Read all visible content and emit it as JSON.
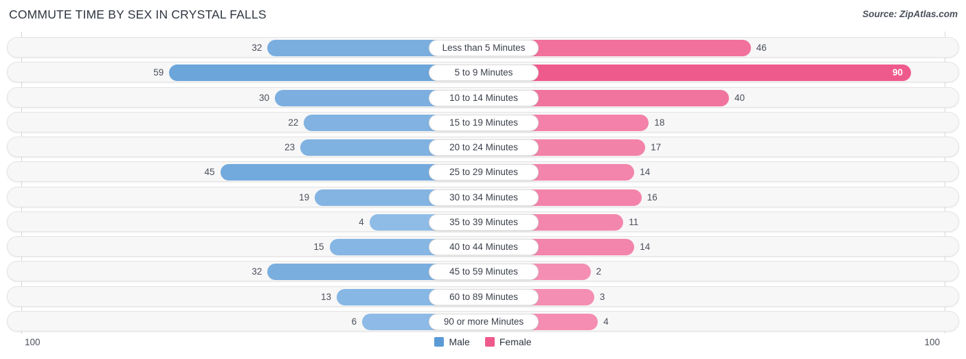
{
  "header": {
    "title": "COMMUTE TIME BY SEX IN CRYSTAL FALLS",
    "source": "Source: ZipAtlas.com"
  },
  "axis": {
    "left_label": "100",
    "right_label": "100"
  },
  "legend": {
    "items": [
      {
        "label": "Male",
        "color": "#5b9bd5"
      },
      {
        "label": "Female",
        "color": "#ef5a8c"
      }
    ]
  },
  "colors": {
    "male_strong": "#5b9bd5",
    "male_light": "#95bfe8",
    "female_strong": "#ef5a8c",
    "female_light": "#f492b5",
    "track": "#f7f7f7",
    "track_border": "#e3e3e3",
    "grid": "#d8d8d8"
  },
  "chart_data": {
    "type": "bar",
    "title": "COMMUTE TIME BY SEX IN CRYSTAL FALLS",
    "subtitle": "Source: ZipAtlas.com",
    "orientation": "horizontal-diverging",
    "xlabel": "",
    "ylabel": "",
    "xlim": [
      0,
      100
    ],
    "grid": true,
    "legend_position": "bottom-center",
    "categories": [
      "Less than 5 Minutes",
      "5 to 9 Minutes",
      "10 to 14 Minutes",
      "15 to 19 Minutes",
      "20 to 24 Minutes",
      "25 to 29 Minutes",
      "30 to 34 Minutes",
      "35 to 39 Minutes",
      "40 to 44 Minutes",
      "45 to 59 Minutes",
      "60 to 89 Minutes",
      "90 or more Minutes"
    ],
    "series": [
      {
        "name": "Male",
        "side": "left",
        "color": "#5b9bd5",
        "values": [
          32,
          59,
          30,
          22,
          23,
          45,
          19,
          4,
          15,
          32,
          13,
          6
        ]
      },
      {
        "name": "Female",
        "side": "right",
        "color": "#ef5a8c",
        "values": [
          46,
          90,
          40,
          18,
          17,
          14,
          16,
          11,
          14,
          2,
          3,
          4
        ]
      }
    ]
  }
}
